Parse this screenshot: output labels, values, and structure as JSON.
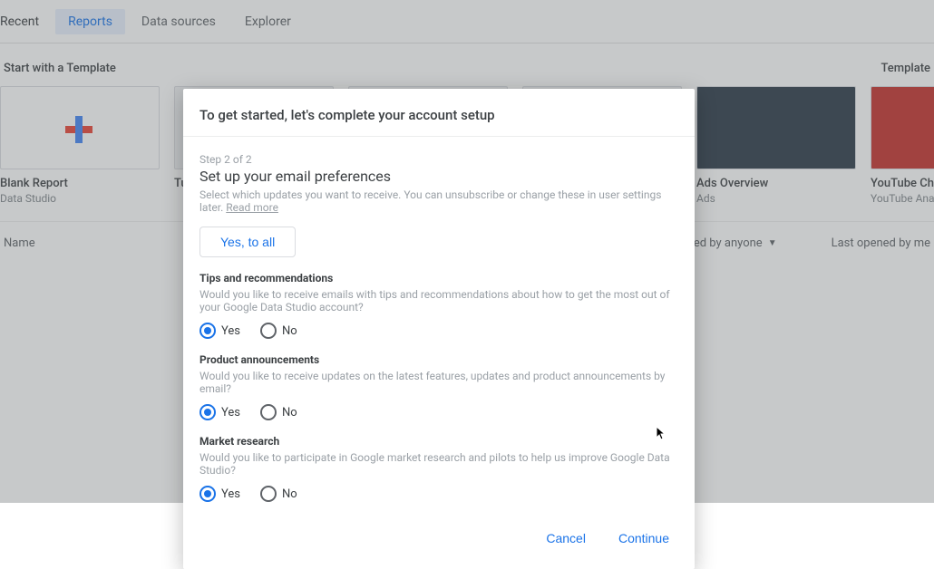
{
  "tabs": {
    "recent": "Recent",
    "reports": "Reports",
    "dataSources": "Data sources",
    "explorer": "Explorer"
  },
  "section": {
    "startWith": "Start with a Template",
    "gallery": "Template"
  },
  "templates": [
    {
      "title": "Blank Report",
      "sub": "Data Studio"
    },
    {
      "title": "Tu",
      "sub": ""
    },
    {
      "title": "",
      "sub": ""
    },
    {
      "title": "",
      "sub": ""
    },
    {
      "title": "Ads Overview",
      "sub": "Ads"
    },
    {
      "title": "YouTube Channel Repo",
      "sub": "YouTube Analytics"
    }
  ],
  "list": {
    "name": "Name",
    "ownedBy": "Owned by anyone",
    "lastOpened": "Last opened by me"
  },
  "dialog": {
    "title": "To get started, let's complete your account setup",
    "step": "Step 2 of 2",
    "subtitle": "Set up your email preferences",
    "subdesc": "Select which updates you want to receive. You can unsubscribe or change these in user settings later. ",
    "readMore": "Read more",
    "yesAll": "Yes, to all",
    "prefs": [
      {
        "title": "Tips and recommendations",
        "desc": "Would you like to receive emails with tips and recommendations about how to get the most out of your Google Data Studio account?"
      },
      {
        "title": "Product announcements",
        "desc": "Would you like to receive updates on the latest features, updates and product announcements by email?"
      },
      {
        "title": "Market research",
        "desc": "Would you like to participate in Google market research and pilots to help us improve Google Data Studio?"
      }
    ],
    "yes": "Yes",
    "no": "No",
    "cancel": "Cancel",
    "continue": "Continue"
  }
}
